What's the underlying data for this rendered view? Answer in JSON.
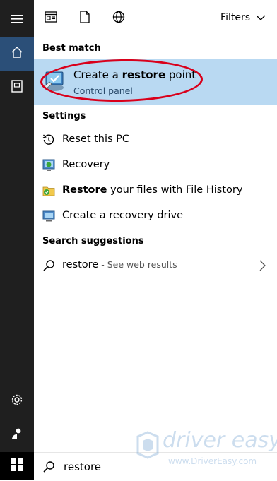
{
  "toolbar": {
    "filters_label": "Filters"
  },
  "best_match": {
    "header": "Best match",
    "title_prefix": "Create a ",
    "title_bold": "restore",
    "title_suffix": " point",
    "subtitle": "Control panel"
  },
  "settings": {
    "header": "Settings",
    "items": [
      {
        "label": "Reset this PC"
      },
      {
        "label": "Recovery"
      },
      {
        "bold": "Restore",
        "rest": " your files with File History"
      },
      {
        "label": "Create a recovery drive"
      }
    ]
  },
  "suggestions": {
    "header": "Search suggestions",
    "query": "restore",
    "hint": " - See web results"
  },
  "search": {
    "value": "restore"
  },
  "watermark": {
    "brand": "driver easy",
    "url": "www.DriverEasy.com"
  },
  "colors": {
    "rail": "#1f1f1f",
    "rail_active": "#2b4f78",
    "highlight": "#b9d9f2",
    "annotation_red": "#d9001b"
  }
}
